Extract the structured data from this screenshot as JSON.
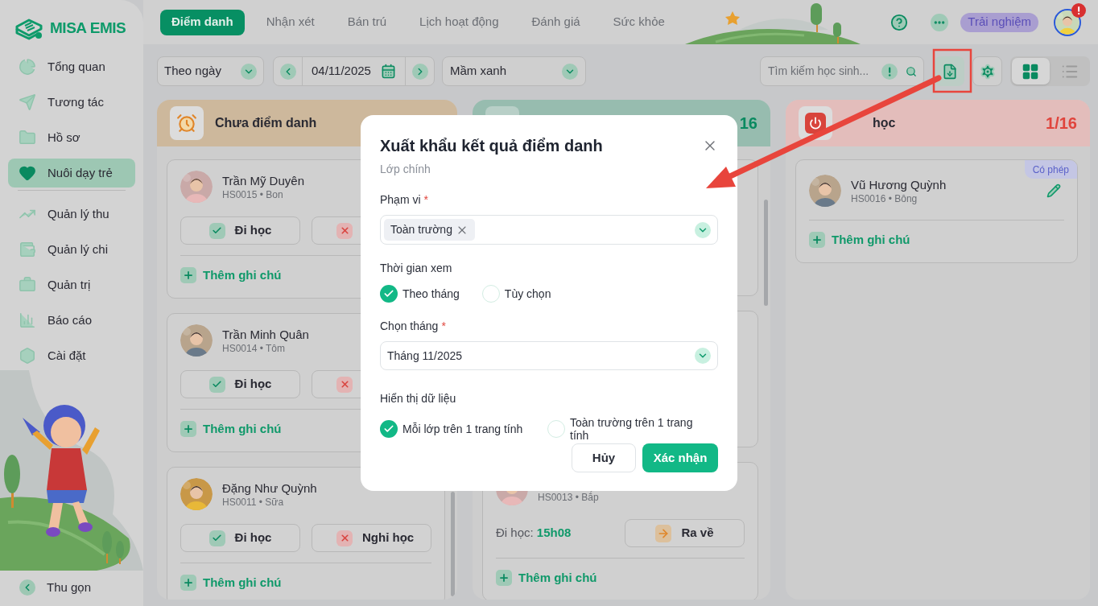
{
  "sidebar": {
    "logo": "MISA EMIS",
    "groups": [
      [
        {
          "label": "Tổng quan",
          "selected": false
        },
        {
          "label": "Tương tác",
          "selected": false
        },
        {
          "label": "Hồ sơ",
          "selected": false
        },
        {
          "label": "Nuôi dạy trẻ",
          "selected": true
        }
      ],
      [
        {
          "label": "Quản lý thu",
          "selected": false
        },
        {
          "label": "Quản lý chi",
          "selected": false
        },
        {
          "label": "Quản trị",
          "selected": false
        },
        {
          "label": "Báo cáo",
          "selected": false
        },
        {
          "label": "Cài đặt",
          "selected": false
        }
      ]
    ],
    "collapse": "Thu gọn"
  },
  "tabs": [
    {
      "label": "Điểm danh",
      "selected": true
    },
    {
      "label": "Nhận xét",
      "selected": false
    },
    {
      "label": "Bán trú",
      "selected": false
    },
    {
      "label": "Lịch hoạt động",
      "selected": false
    },
    {
      "label": "Đánh giá",
      "selected": false
    },
    {
      "label": "Sức khỏe",
      "selected": false
    }
  ],
  "header": {
    "trial": "Trải nghiệm",
    "alert": true
  },
  "toolbar": {
    "mode_select": "Theo ngày",
    "date": "04/11/2025",
    "class_select": "Mầm xanh",
    "search": {
      "placeholder": "Tìm kiếm học sinh..."
    },
    "view": [
      {
        "kind": "grid",
        "selected": true
      },
      {
        "kind": "list",
        "selected": false
      }
    ]
  },
  "columns": [
    {
      "kind": "pending",
      "title": "Chưa điểm danh",
      "cards": [
        {
          "kind": "pending",
          "name": "Trần Mỹ Duyên",
          "subtitle": "HS0015 • Bon",
          "actions": [
            {
              "kind": "present",
              "label": "Đi học"
            },
            {
              "kind": "absent"
            }
          ],
          "note": "Thêm ghi chú"
        },
        {
          "kind": "pending",
          "name": "Trần Minh Quân",
          "subtitle": "HS0014 • Tôm",
          "actions": [
            {
              "kind": "present",
              "label": "Đi học"
            },
            {
              "kind": "absent"
            }
          ],
          "note": "Thêm ghi chú"
        },
        {
          "kind": "pending",
          "name": "Đặng Như Quỳnh",
          "subtitle": "HS0011 • Sữa",
          "actions": [
            {
              "kind": "present",
              "label": "Đi học"
            },
            {
              "kind": "absent",
              "label": "Nghỉ học"
            }
          ],
          "note": "Thêm ghi chú"
        }
      ]
    },
    {
      "kind": "present",
      "count": "16",
      "cards": [
        {
          "kind": "covered"
        },
        {
          "kind": "covered"
        },
        {
          "kind": "checked_in",
          "subtitle": "HS0013 • Bắp",
          "checkin_label": "Đi học:",
          "checkin_time": "15h08",
          "actions": [
            {
              "kind": "leave",
              "label": "Ra về"
            }
          ],
          "note": "Thêm ghi chú"
        }
      ]
    },
    {
      "kind": "absent",
      "title": "học",
      "count": "1/16",
      "cards": [
        {
          "kind": "absent",
          "name": "Vũ Hương Quỳnh",
          "subtitle": "HS0016 • Bông",
          "badge": "Có phép",
          "note": "Thêm ghi chú"
        }
      ]
    }
  ],
  "dialog": {
    "title": "Xuất khẩu kết quả điểm danh",
    "subtitle": "Lớp chính",
    "scope": {
      "label": "Phạm vi",
      "required_mark": "*",
      "tags": [
        "Toàn trường"
      ]
    },
    "period": {
      "label": "Thời gian xem",
      "options": [
        {
          "label": "Theo tháng",
          "selected": true
        },
        {
          "label": "Tùy chọn",
          "selected": false
        }
      ]
    },
    "month": {
      "label": "Chọn tháng",
      "required_mark": "*",
      "value": "Tháng 11/2025"
    },
    "layout": {
      "label": "Hiển thị dữ liệu",
      "options": [
        {
          "label": "Mỗi lớp trên 1 trang tính",
          "selected": true
        },
        {
          "label": "Toàn trường trên 1 trang tính",
          "selected": false
        }
      ]
    },
    "buttons": [
      {
        "kind": "secondary",
        "label": "Hủy"
      },
      {
        "kind": "primary",
        "label": "Xác nhận"
      }
    ]
  },
  "annotations": {
    "highlight_box": true,
    "arrow": true
  }
}
